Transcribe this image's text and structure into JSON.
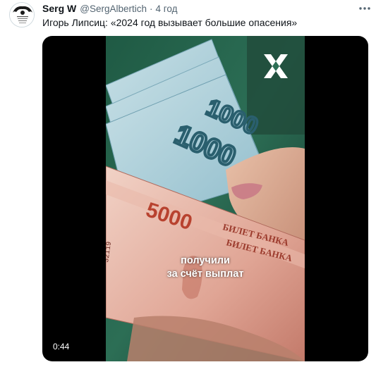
{
  "tweet": {
    "author_name": "Serg W",
    "author_handle": "@SergAlbertich",
    "separator": "·",
    "time": "4 год",
    "text": "Игорь Липсиц: «2024 год вызывает большие опасения»"
  },
  "media": {
    "caption_lines": [
      "получили",
      "за счёт выплат"
    ],
    "duration": "0:44",
    "banknote_5000_label": "5000",
    "banknote_1000_label": "1000",
    "banknote_text": "БИЛЕТ БАНКА",
    "serial_partial": "32119"
  },
  "icons": {
    "more": "more-horizontal-icon",
    "brand": "x-shaped-brand-logo"
  },
  "colors": {
    "handle": "#536471",
    "media_bg": "#000000",
    "banknote_blue": "#9fc8d6",
    "banknote_red": "#d98a7a"
  }
}
